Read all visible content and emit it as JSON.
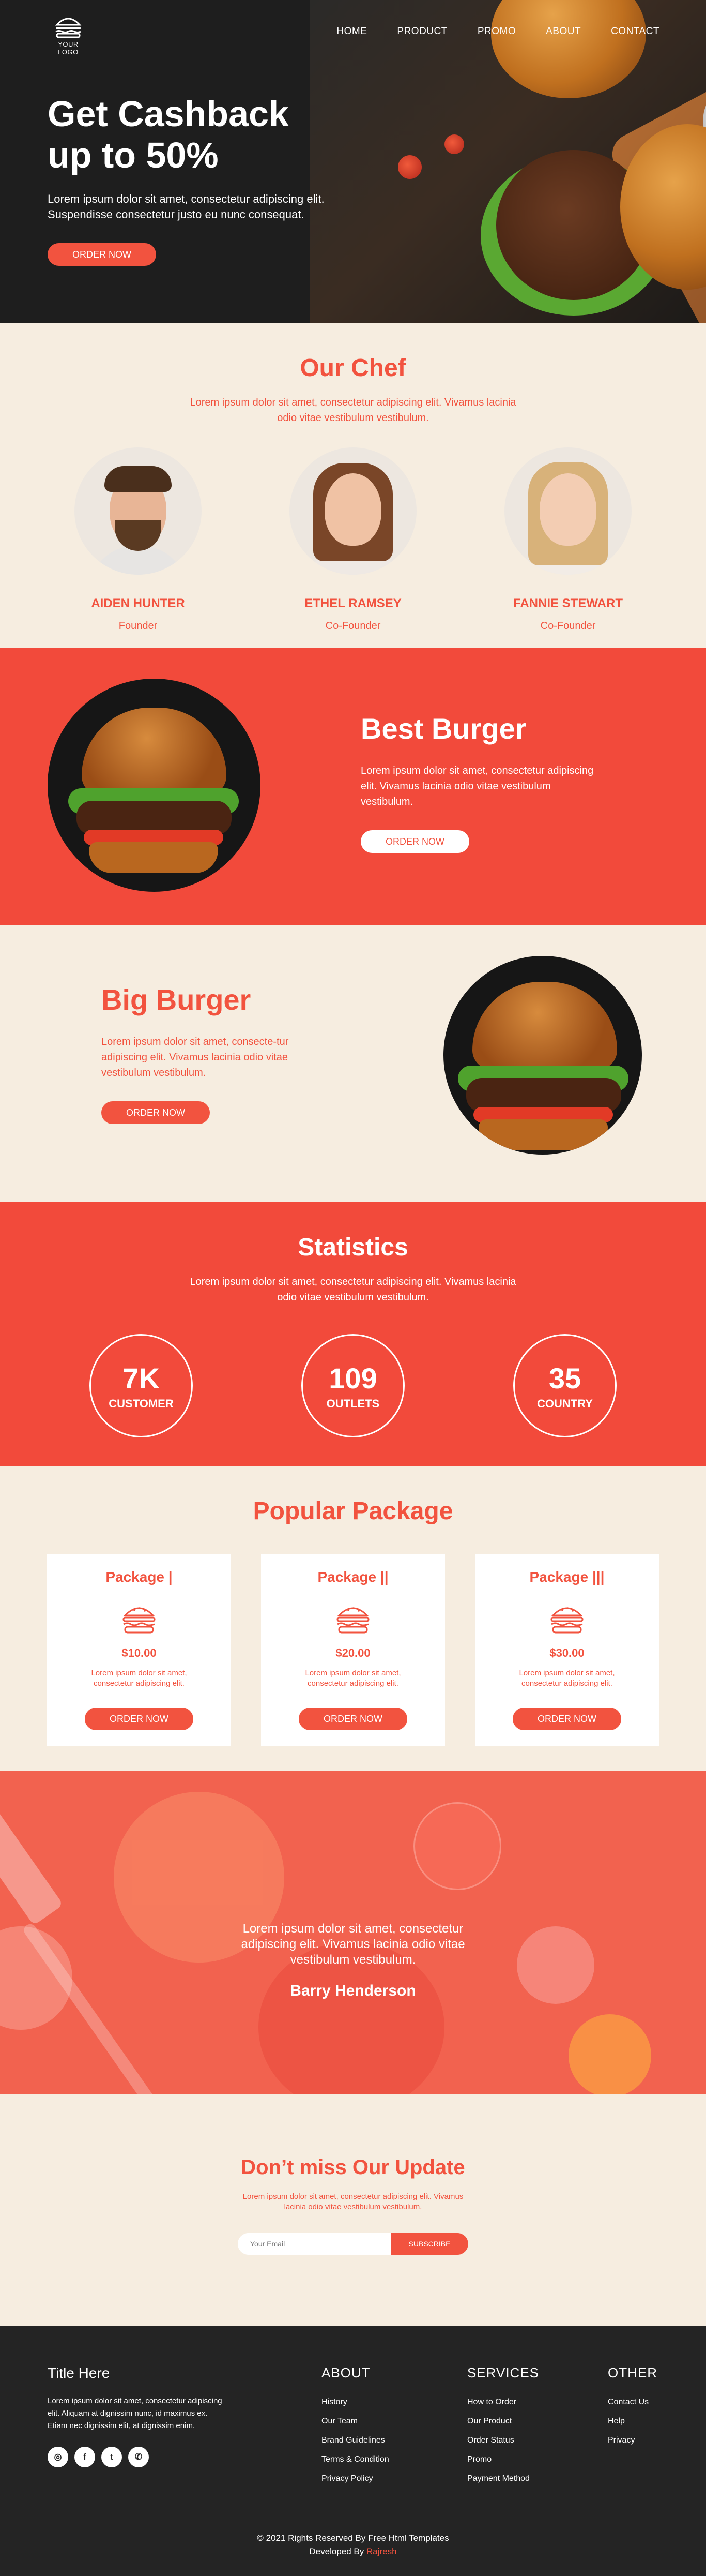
{
  "nav": {
    "logo_text": "YOUR LOGO",
    "items": [
      "HOME",
      "PRODUCT",
      "PROMO",
      "ABOUT",
      "CONTACT"
    ]
  },
  "hero": {
    "title_line1": "Get Cashback",
    "title_line2": "up to 50%",
    "text": "Lorem ipsum dolor sit amet, consectetur adipiscing elit. Suspendisse consectetur justo eu nunc consequat.",
    "button": "ORDER NOW"
  },
  "chef": {
    "title": "Our Chef",
    "subtitle": "Lorem ipsum dolor sit amet, consectetur adipiscing elit. Vivamus lacinia odio vitae vestibulum vestibulum.",
    "members": [
      {
        "name": "AIDEN HUNTER",
        "role": "Founder"
      },
      {
        "name": "ETHEL RAMSEY",
        "role": "Co-Founder"
      },
      {
        "name": "FANNIE STEWART",
        "role": "Co-Founder"
      }
    ]
  },
  "best_burger": {
    "title": "Best Burger",
    "text": "Lorem ipsum dolor sit amet, consectetur adipiscing elit. Vivamus lacinia odio vitae vestibulum vestibulum.",
    "button": "ORDER NOW"
  },
  "big_burger": {
    "title": "Big Burger",
    "text": "Lorem ipsum dolor sit amet, consecte-tur adipiscing elit. Vivamus lacinia odio vitae vestibulum vestibulum.",
    "button": "ORDER NOW"
  },
  "stats": {
    "title": "Statistics",
    "subtitle": "Lorem ipsum dolor sit amet, consectetur adipiscing elit. Vivamus lacinia odio vitae vestibulum vestibulum.",
    "items": [
      {
        "value": "7K",
        "label": "CUSTOMER"
      },
      {
        "value": "109",
        "label": "OUTLETS"
      },
      {
        "value": "35",
        "label": "COUNTRY"
      }
    ]
  },
  "packages": {
    "title": "Popular Package",
    "items": [
      {
        "name": "Package |",
        "price": "$10.00",
        "desc": "Lorem ipsum dolor sit amet, consectetur adipiscing elit.",
        "button": "ORDER NOW"
      },
      {
        "name": "Package ||",
        "price": "$20.00",
        "desc": "Lorem ipsum dolor sit amet, consectetur adipiscing elit.",
        "button": "ORDER NOW"
      },
      {
        "name": "Package |||",
        "price": "$30.00",
        "desc": "Lorem ipsum dolor sit amet, consectetur adipiscing elit.",
        "button": "ORDER NOW"
      }
    ]
  },
  "testimonial": {
    "quote": "Lorem ipsum dolor sit amet, consectetur adipiscing elit. Vivamus lacinia odio vitae vestibulum vestibulum.",
    "author": "Barry Henderson"
  },
  "newsletter": {
    "title": "Don’t miss Our Update",
    "subtitle": "Lorem ipsum dolor sit amet, consectetur adipiscing elit. Vivamus lacinia odio vitae vestibulum vestibulum.",
    "placeholder": "Your Email",
    "button": "SUBSCRIBE"
  },
  "footer": {
    "title": "Title Here",
    "text": "Lorem ipsum dolor sit amet, consectetur adipiscing elit. Aliquam at dignissim nunc, id maximus ex. Etiam nec dignissim elit, at dignissim enim.",
    "socials": [
      {
        "icon": "instagram-icon",
        "glyph": "◎"
      },
      {
        "icon": "facebook-icon",
        "glyph": "f"
      },
      {
        "icon": "twitter-icon",
        "glyph": "t"
      },
      {
        "icon": "whatsapp-icon",
        "glyph": "✆"
      }
    ],
    "columns": [
      {
        "heading": "ABOUT",
        "links": [
          "History",
          "Our Team",
          "Brand Guidelines",
          "Terms & Condition",
          "Privacy Policy"
        ]
      },
      {
        "heading": "SERVICES",
        "links": [
          "How to Order",
          "Our Product",
          "Order Status",
          "Promo",
          "Payment Method"
        ]
      },
      {
        "heading": "OTHER",
        "links": [
          "Contact Us",
          "Help",
          "Privacy"
        ]
      }
    ],
    "copyright": "© 2021 Rights Reserved By Free Html Templates",
    "developed_by": "Developed By",
    "developer": "Rajresh"
  },
  "colors": {
    "accent": "#f2533f",
    "cream": "#f6ede0",
    "dark": "#242424"
  }
}
